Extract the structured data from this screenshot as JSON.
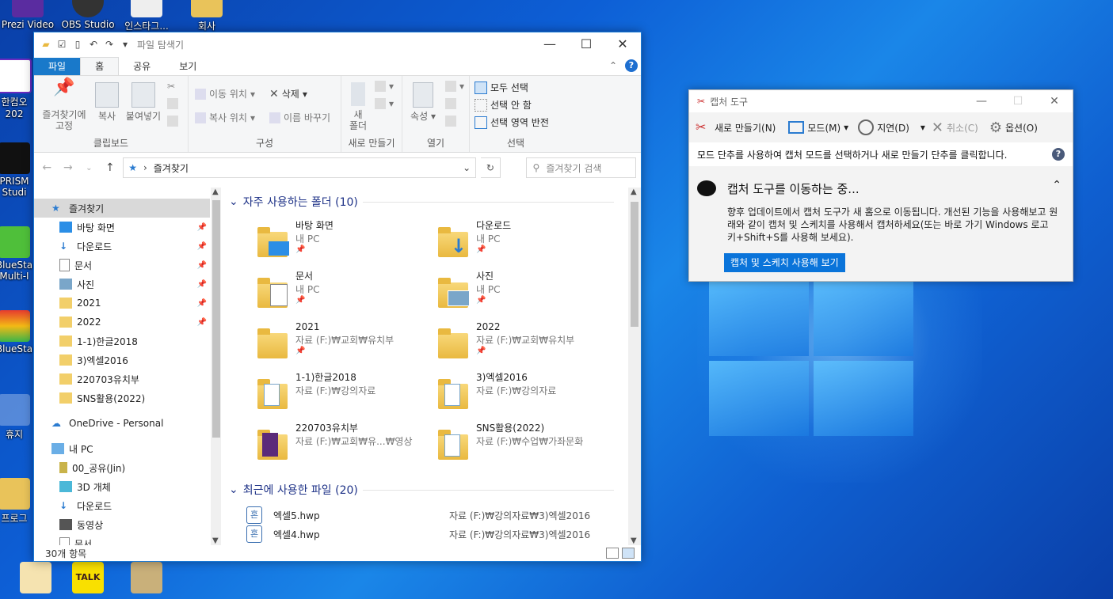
{
  "desktop": {
    "icons": [
      {
        "label": "Prezi Video"
      },
      {
        "label": "OBS Studio"
      },
      {
        "label": "인스타그..."
      },
      {
        "label": "회사"
      },
      {
        "label": "한컴오\n202"
      },
      {
        "label": "PRISM\nStudi"
      },
      {
        "label": "BlueSta\nMulti-I"
      },
      {
        "label": "BlueSta"
      },
      {
        "label": "휴지"
      },
      {
        "label": "프로그"
      },
      {
        "label": "TALK"
      }
    ]
  },
  "explorer": {
    "title": "파일 탐색기",
    "tabs": [
      "파일",
      "홈",
      "공유",
      "보기"
    ],
    "ribbon": {
      "clipboard": {
        "label": "클립보드",
        "pin": "즐겨찾기에\n고정",
        "copy": "복사",
        "paste": "붙여넣기"
      },
      "organize": {
        "label": "구성",
        "move": "이동 위치",
        "copyto": "복사 위치",
        "delete": "삭제",
        "rename": "이름 바꾸기"
      },
      "new": {
        "label": "새로 만들기",
        "newfolder": "새\n폴더"
      },
      "open": {
        "label": "열기",
        "props": "속성"
      },
      "select": {
        "label": "선택",
        "all": "모두 선택",
        "none": "선택 안 함",
        "invert": "선택 영역 반전"
      }
    },
    "address": {
      "path": "즐겨찾기",
      "search_placeholder": "즐겨찾기 검색"
    },
    "nav": [
      {
        "label": "즐겨찾기",
        "icon": "star-icon",
        "selected": true,
        "pinned": false
      },
      {
        "label": "바탕 화면",
        "icon": "desktop-icon",
        "pinned": true
      },
      {
        "label": "다운로드",
        "icon": "download-icon",
        "pinned": true
      },
      {
        "label": "문서",
        "icon": "document-icon",
        "pinned": true
      },
      {
        "label": "사진",
        "icon": "pictures-icon",
        "pinned": true
      },
      {
        "label": "2021",
        "icon": "folder-icon",
        "pinned": true
      },
      {
        "label": "2022",
        "icon": "folder-icon",
        "pinned": true
      },
      {
        "label": "1-1)한글2018",
        "icon": "folder-icon",
        "pinned": false
      },
      {
        "label": "3)엑셀2016",
        "icon": "folder-icon",
        "pinned": false
      },
      {
        "label": "220703유치부",
        "icon": "folder-icon",
        "pinned": false
      },
      {
        "label": "SNS활용(2022)",
        "icon": "folder-icon",
        "pinned": false
      },
      {
        "label": "OneDrive - Personal",
        "icon": "cloud-icon",
        "pinned": false
      },
      {
        "label": "내 PC",
        "icon": "pc-icon",
        "pinned": false
      },
      {
        "label": "00_공유(Jin)",
        "icon": "network-drive-icon",
        "pinned": false
      },
      {
        "label": "3D 개체",
        "icon": "3d-icon",
        "pinned": false
      },
      {
        "label": "다운로드",
        "icon": "download-icon",
        "pinned": false
      },
      {
        "label": "동영상",
        "icon": "video-icon",
        "pinned": false
      },
      {
        "label": "문서",
        "icon": "document-icon",
        "pinned": false
      }
    ],
    "frequent": {
      "header": "자주 사용하는 폴더 (10)",
      "items": [
        {
          "name": "바탕 화면",
          "path": "내 PC",
          "pinned": true
        },
        {
          "name": "다운로드",
          "path": "내 PC",
          "pinned": true
        },
        {
          "name": "문서",
          "path": "내 PC",
          "pinned": true
        },
        {
          "name": "사진",
          "path": "내 PC",
          "pinned": true
        },
        {
          "name": "2021",
          "path": "자료 (F:)₩교회₩유치부",
          "pinned": true
        },
        {
          "name": "2022",
          "path": "자료 (F:)₩교회₩유치부",
          "pinned": true
        },
        {
          "name": "1-1)한글2018",
          "path": "자료 (F:)₩강의자료",
          "pinned": false
        },
        {
          "name": "3)엑셀2016",
          "path": "자료 (F:)₩강의자료",
          "pinned": false
        },
        {
          "name": "220703유치부",
          "path": "자료 (F:)₩교회₩유...₩영상",
          "pinned": false
        },
        {
          "name": "SNS활용(2022)",
          "path": "자료 (F:)₩수업₩가좌문화",
          "pinned": false
        }
      ]
    },
    "recent": {
      "header": "최근에 사용한 파일 (20)",
      "items": [
        {
          "name": "엑셀5.hwp",
          "path": "자료 (F:)₩강의자료₩3)엑셀2016"
        },
        {
          "name": "엑셀4.hwp",
          "path": "자료 (F:)₩강의자료₩3)엑셀2016"
        }
      ]
    },
    "status": "30개 항목"
  },
  "snip": {
    "title": "캡처 도구",
    "toolbar": {
      "new": "새로 만들기(N)",
      "mode": "모드(M)",
      "delay": "지연(D)",
      "cancel": "취소(C)",
      "options": "옵션(O)"
    },
    "hint": "모드 단추를 사용하여 캡처 모드를 선택하거나 새로 만들기 단추를 클릭합니다.",
    "notice_title": "캡처 도구를 이동하는 중...",
    "notice_body": "향후 업데이트에서 캡처 도구가 새 홈으로 이동됩니다. 개선된 기능을 사용해보고 원래와 같이 캡처 및 스케치를 사용해서 캡처하세요(또는 바로 가기 Windows 로고 키+Shift+S를 사용해 보세요).",
    "notice_button": "캡처 및 스케치 사용해 보기"
  },
  "colors": {
    "accent": "#1979ca",
    "folder": "#e9b940",
    "snip_button": "#0a74da"
  }
}
